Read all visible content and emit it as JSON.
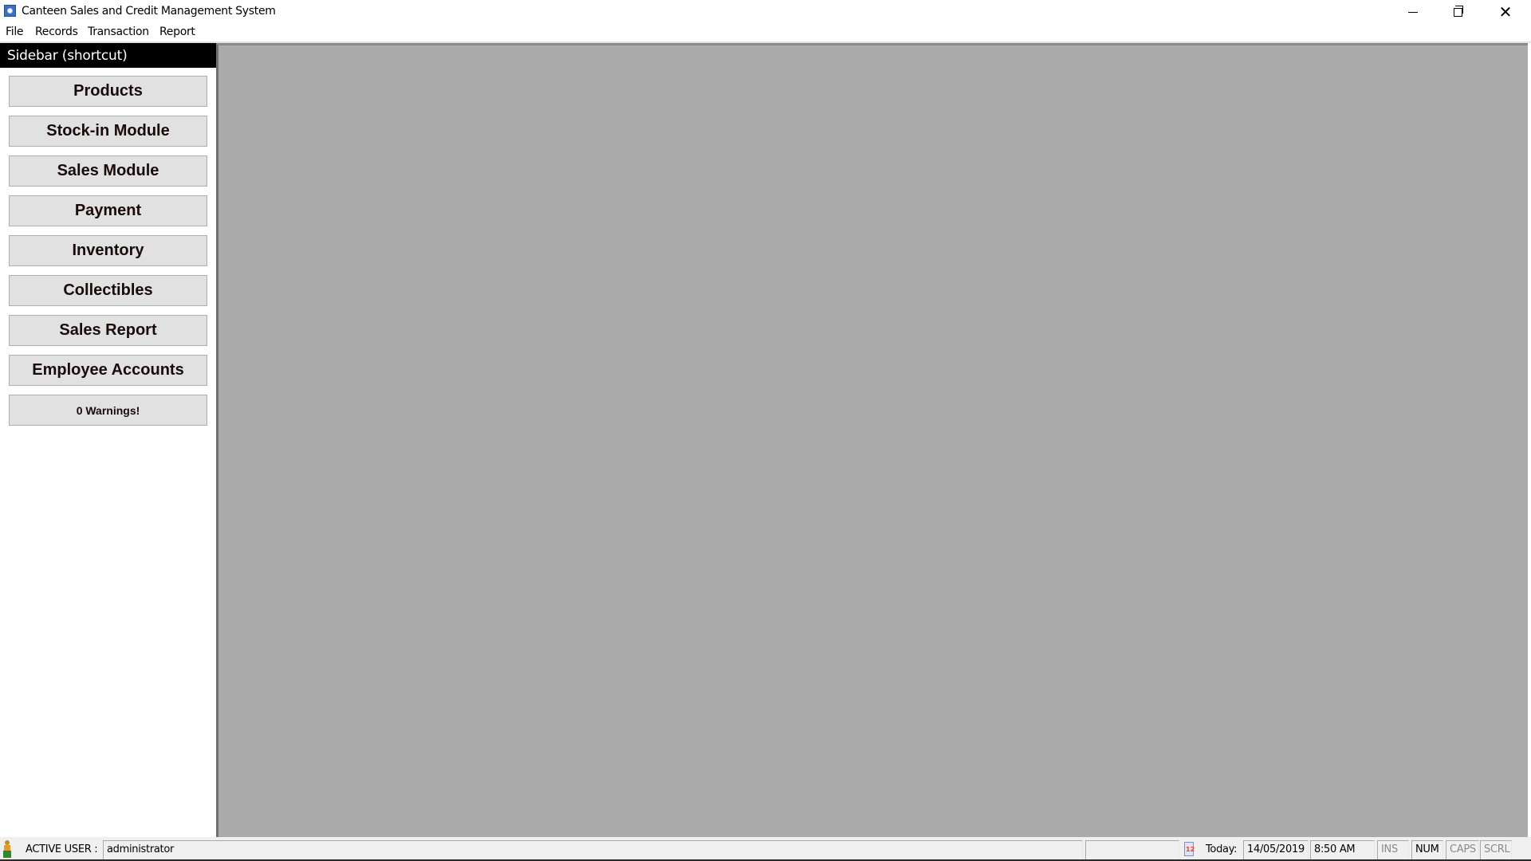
{
  "window": {
    "title": "Canteen Sales and Credit Management System",
    "icon": "gear-app-icon",
    "controls": {
      "minimize": "minimize-icon",
      "maximize": "restore-icon",
      "close": "close-icon"
    }
  },
  "menu": {
    "items": [
      {
        "label": "File"
      },
      {
        "label": "Records"
      },
      {
        "label": "Transaction"
      },
      {
        "label": "Report"
      }
    ]
  },
  "sidebar": {
    "header": "Sidebar (shortcut)",
    "buttons": [
      {
        "label": "Products"
      },
      {
        "label": "Stock-in Module"
      },
      {
        "label": "Sales Module"
      },
      {
        "label": "Payment"
      },
      {
        "label": "Inventory"
      },
      {
        "label": "Collectibles"
      },
      {
        "label": "Sales Report"
      },
      {
        "label": "Employee Accounts"
      },
      {
        "label": "0 Warnings!"
      }
    ]
  },
  "statusbar": {
    "user_label": "ACTIVE USER :",
    "user_value": "administrator",
    "empty_panel": "",
    "today_label": "Today:",
    "date": "14/05/2019",
    "time": "8:50 AM",
    "keys": {
      "ins": "INS",
      "num": "NUM",
      "caps": "CAPS",
      "scrl": "SCRL"
    },
    "key_states": {
      "ins": false,
      "num": true,
      "caps": false,
      "scrl": false
    }
  },
  "colors": {
    "mdi_background": "#ababab",
    "sidebar_header": "#000000",
    "button_face": "#e1e1e1"
  }
}
